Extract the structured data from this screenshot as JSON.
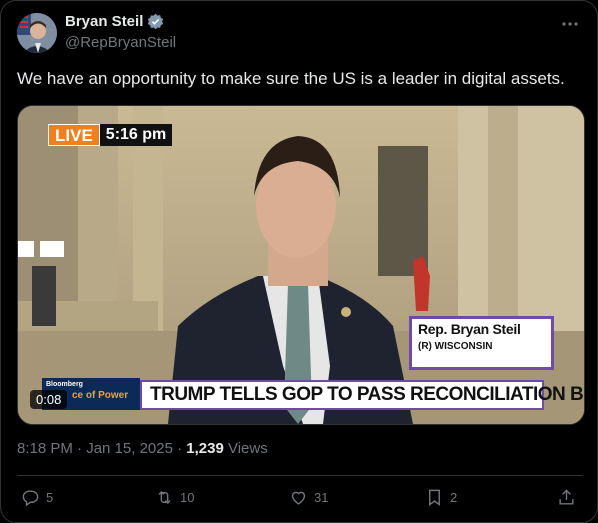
{
  "post": {
    "author_name": "Bryan Steil",
    "handle": "@RepBryanSteil",
    "verified_icon": "verified-badge-icon",
    "text": "We have an opportunity to make sure the US is a leader in digital assets.",
    "timestamp": "8:18 PM · Jan 15, 2025 · ",
    "views_count": "1,239",
    "views_label": "Views"
  },
  "video": {
    "live_tag": "LIVE",
    "live_time": "5:16 pm",
    "chyron_name": "Rep. Bryan Steil",
    "chyron_state": "(R) WISCONSIN",
    "headline": "TRUMP TELLS GOP TO PASS RECONCILIATION BILL",
    "network_text": "Bloomberg",
    "network_show": "ce of Power",
    "elapsed": "0:08"
  },
  "actions": {
    "replies": "5",
    "reposts": "10",
    "likes": "31",
    "bookmarks": "2"
  },
  "colors": {
    "accent_live": "#f07f1f",
    "chyron_border": "#6f4aa8",
    "muted": "#71767b",
    "text": "#e7e9ea"
  }
}
